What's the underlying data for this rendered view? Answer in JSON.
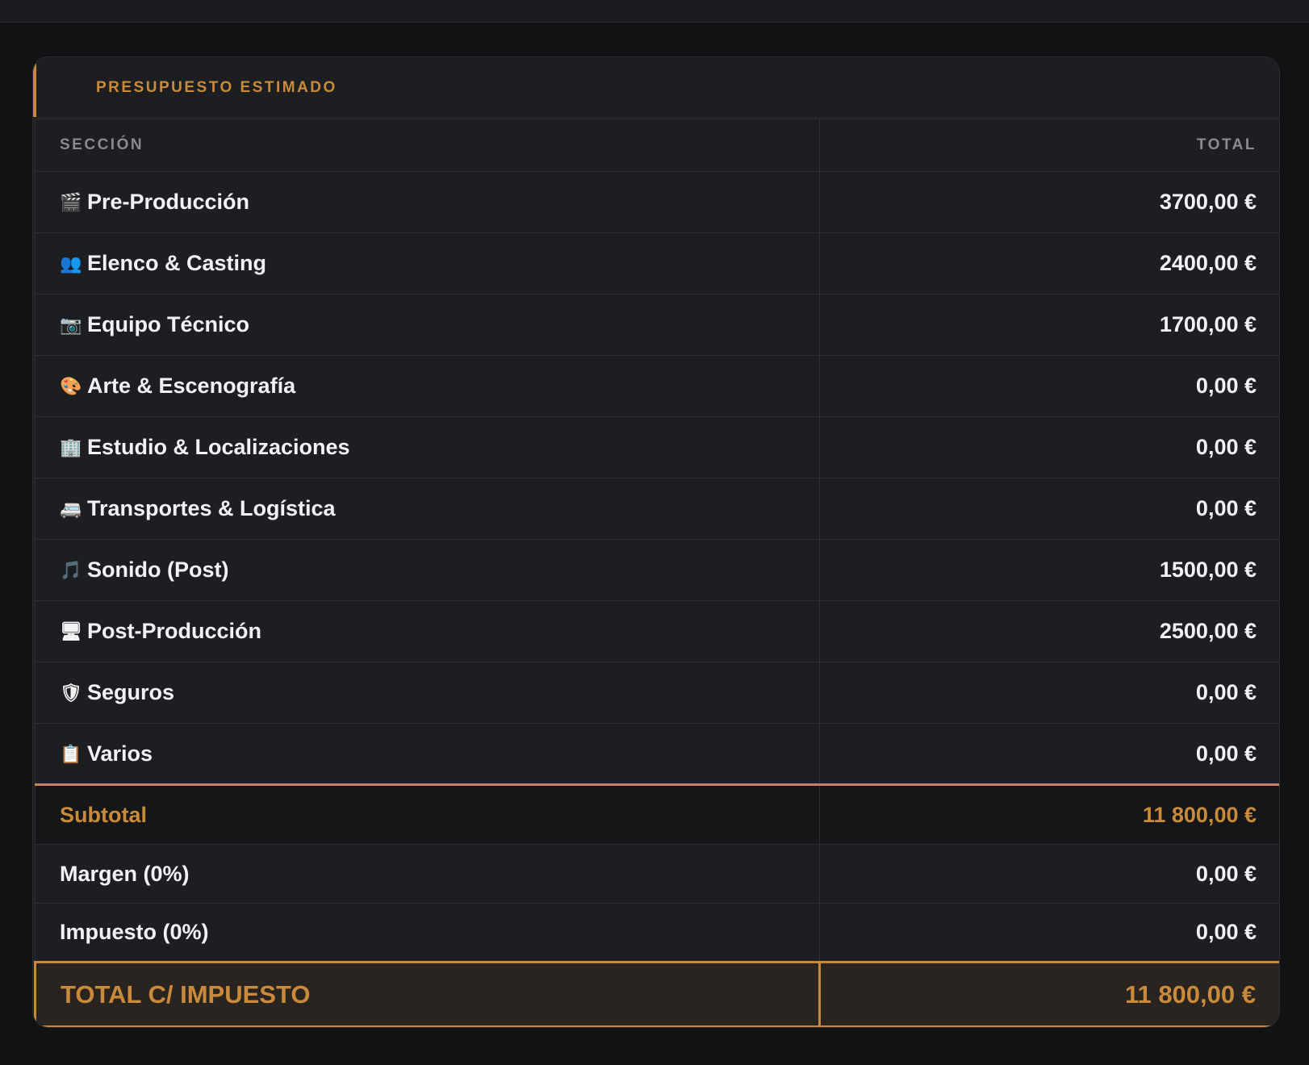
{
  "card": {
    "title": "PRESUPUESTO ESTIMADO"
  },
  "table": {
    "headers": {
      "section": "SECCIÓN",
      "total": "TOTAL"
    },
    "rows": [
      {
        "icon": "🎬",
        "icon_name": "clapperboard-icon",
        "label": "Pre-Producción",
        "amount": "3700,00 €"
      },
      {
        "icon": "👥",
        "icon_name": "people-icon",
        "label": "Elenco & Casting",
        "amount": "2400,00 €"
      },
      {
        "icon": "📷",
        "icon_name": "camera-icon",
        "label": "Equipo Técnico",
        "amount": "1700,00 €"
      },
      {
        "icon": "🎨",
        "icon_name": "palette-icon",
        "label": "Arte & Escenografía",
        "amount": "0,00 €"
      },
      {
        "icon": "🏢",
        "icon_name": "building-icon",
        "label": "Estudio & Localizaciones",
        "amount": "0,00 €"
      },
      {
        "icon": "🚐",
        "icon_name": "van-icon",
        "label": "Transportes & Logística",
        "amount": "0,00 €"
      },
      {
        "icon": "🎵",
        "icon_name": "music-note-icon",
        "label": "Sonido (Post)",
        "amount": "1500,00 €"
      },
      {
        "icon": "🖥",
        "icon_name": "monitor-icon",
        "label": "Post-Producción",
        "amount": "2500,00 €"
      },
      {
        "icon": "🛡",
        "icon_name": "shield-icon",
        "label": "Seguros",
        "amount": "0,00 €"
      },
      {
        "icon": "📋",
        "icon_name": "clipboard-icon",
        "label": "Varios",
        "amount": "0,00 €"
      }
    ],
    "subtotal": {
      "label": "Subtotal",
      "amount": "11 800,00 €"
    },
    "margin": {
      "label": "Margen (0%)",
      "amount": "0,00 €"
    },
    "tax": {
      "label": "Impuesto (0%)",
      "amount": "0,00 €"
    },
    "grand_total": {
      "label": "TOTAL C/ IMPUESTO",
      "amount": "11 800,00 €"
    }
  },
  "colors": {
    "accent": "#c88a3a",
    "background": "#111214",
    "card": "#1d1e21",
    "text": "#f2f2f4",
    "muted": "#8a8a92"
  }
}
